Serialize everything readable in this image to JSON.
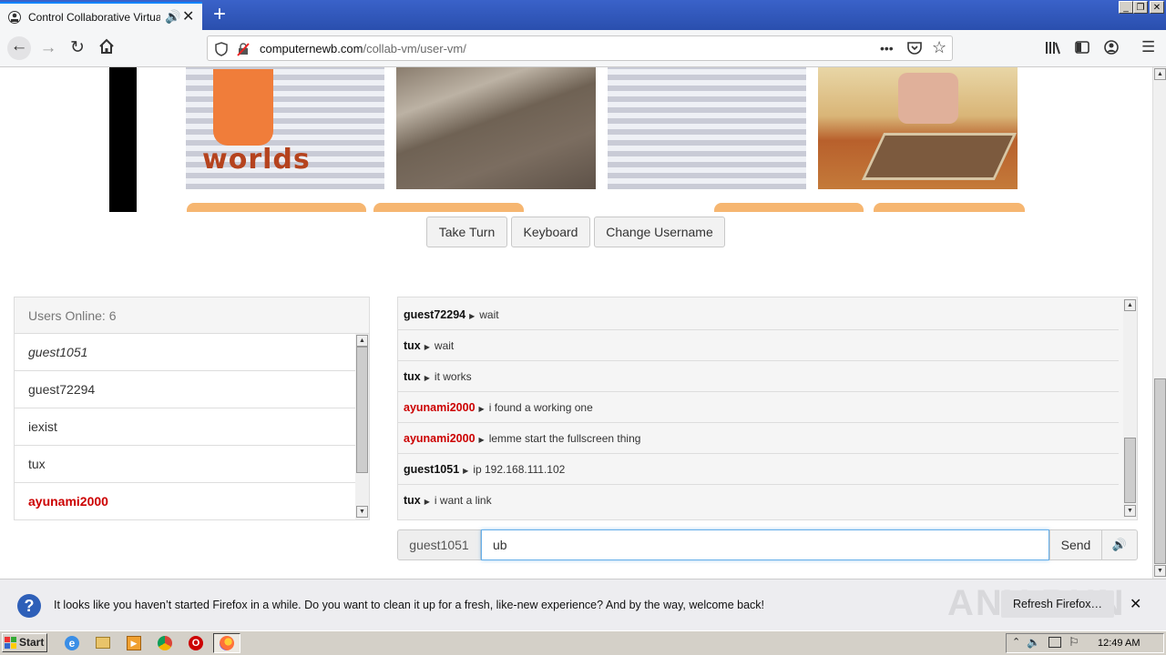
{
  "browser": {
    "tab_title": "Control Collaborative Virtual M",
    "url_domain": "computernewb.com",
    "url_path": "/collab-vm/user-vm/",
    "overflow_label": "•••"
  },
  "vm_thumbnails": [
    {
      "name": "worlds",
      "caption": "worlds"
    },
    {
      "name": "mountain"
    },
    {
      "name": "tiles"
    },
    {
      "name": "room"
    }
  ],
  "controls": {
    "take_turn": "Take Turn",
    "keyboard": "Keyboard",
    "change_username": "Change Username"
  },
  "users": {
    "header": "Users Online: 6",
    "list": [
      {
        "name": "guest1051",
        "style": "italic"
      },
      {
        "name": "guest72294",
        "style": "normal"
      },
      {
        "name": "iexist",
        "style": "normal"
      },
      {
        "name": "tux",
        "style": "normal"
      },
      {
        "name": "ayunami2000",
        "style": "admin"
      }
    ]
  },
  "chat": {
    "messages": [
      {
        "user": "guest72294",
        "text": "wait",
        "admin": false
      },
      {
        "user": "tux",
        "text": "wait",
        "admin": false
      },
      {
        "user": "tux",
        "text": "it works",
        "admin": false
      },
      {
        "user": "ayunami2000",
        "text": "i found a working one",
        "admin": true
      },
      {
        "user": "ayunami2000",
        "text": "lemme start the fullscreen thing",
        "admin": true
      },
      {
        "user": "guest1051",
        "text": "ip 192.168.111.102",
        "admin": false
      },
      {
        "user": "tux",
        "text": "i want a link",
        "admin": false
      }
    ],
    "username_label": "guest1051",
    "input_value": "ub",
    "send_label": "Send"
  },
  "notification": {
    "text": "It looks like you haven’t started Firefox in a while. Do you want to clean it up for a fresh, like-new experience? And by the way, welcome back!",
    "button": "Refresh Firefox…",
    "watermark": "ANY RUN"
  },
  "taskbar": {
    "start_label": "Start",
    "clock": "12:49 AM"
  },
  "colors": {
    "admin_red": "#cc0000",
    "accent_blue": "#0a84ff"
  }
}
